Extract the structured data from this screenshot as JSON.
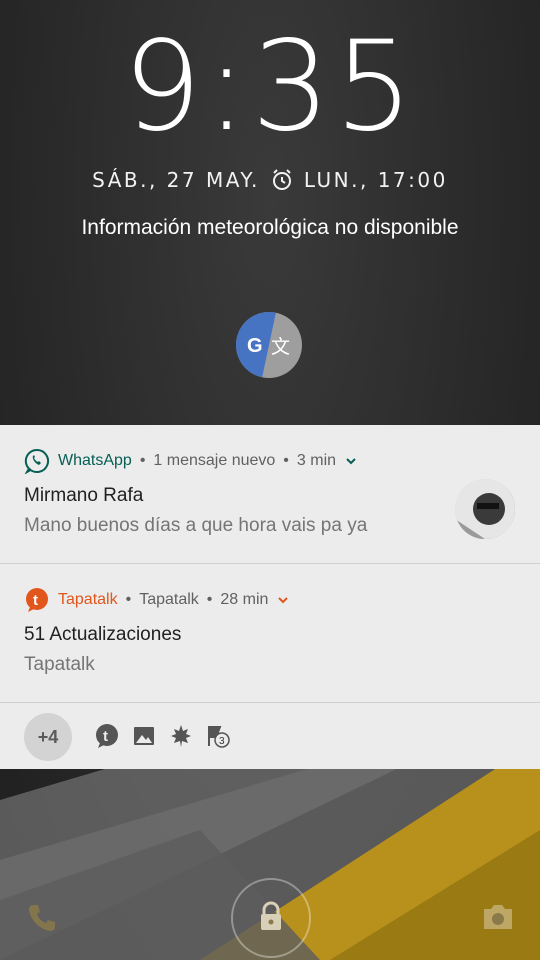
{
  "lockscreen": {
    "clock": "9:35",
    "date": "SÁB., 27 MAY.",
    "alarm": "LUN., 17:00",
    "weather": "Información meteorológica no disponible"
  },
  "notifications": [
    {
      "app": "WhatsApp",
      "meta": "1 mensaje nuevo",
      "time": "3 min",
      "title": "Mirmano Rafa",
      "body": "Mano buenos días a que hora vais pa ya",
      "accent": "#075e54",
      "icon": "whatsapp-icon"
    },
    {
      "app": "Tapatalk",
      "meta": "Tapatalk",
      "time": "28 min",
      "title": "51 Actualizaciones",
      "body": "Tapatalk",
      "accent": "#e0561c",
      "icon": "tapatalk-icon"
    }
  ],
  "overflow": {
    "count": "+4",
    "icons": [
      "tapatalk-icon",
      "image-icon",
      "leaf-icon",
      "flag-badge-icon"
    ],
    "flag_badge": "3"
  },
  "bottom": {
    "left": "phone-icon",
    "center": "lock-icon",
    "right": "camera-icon"
  }
}
